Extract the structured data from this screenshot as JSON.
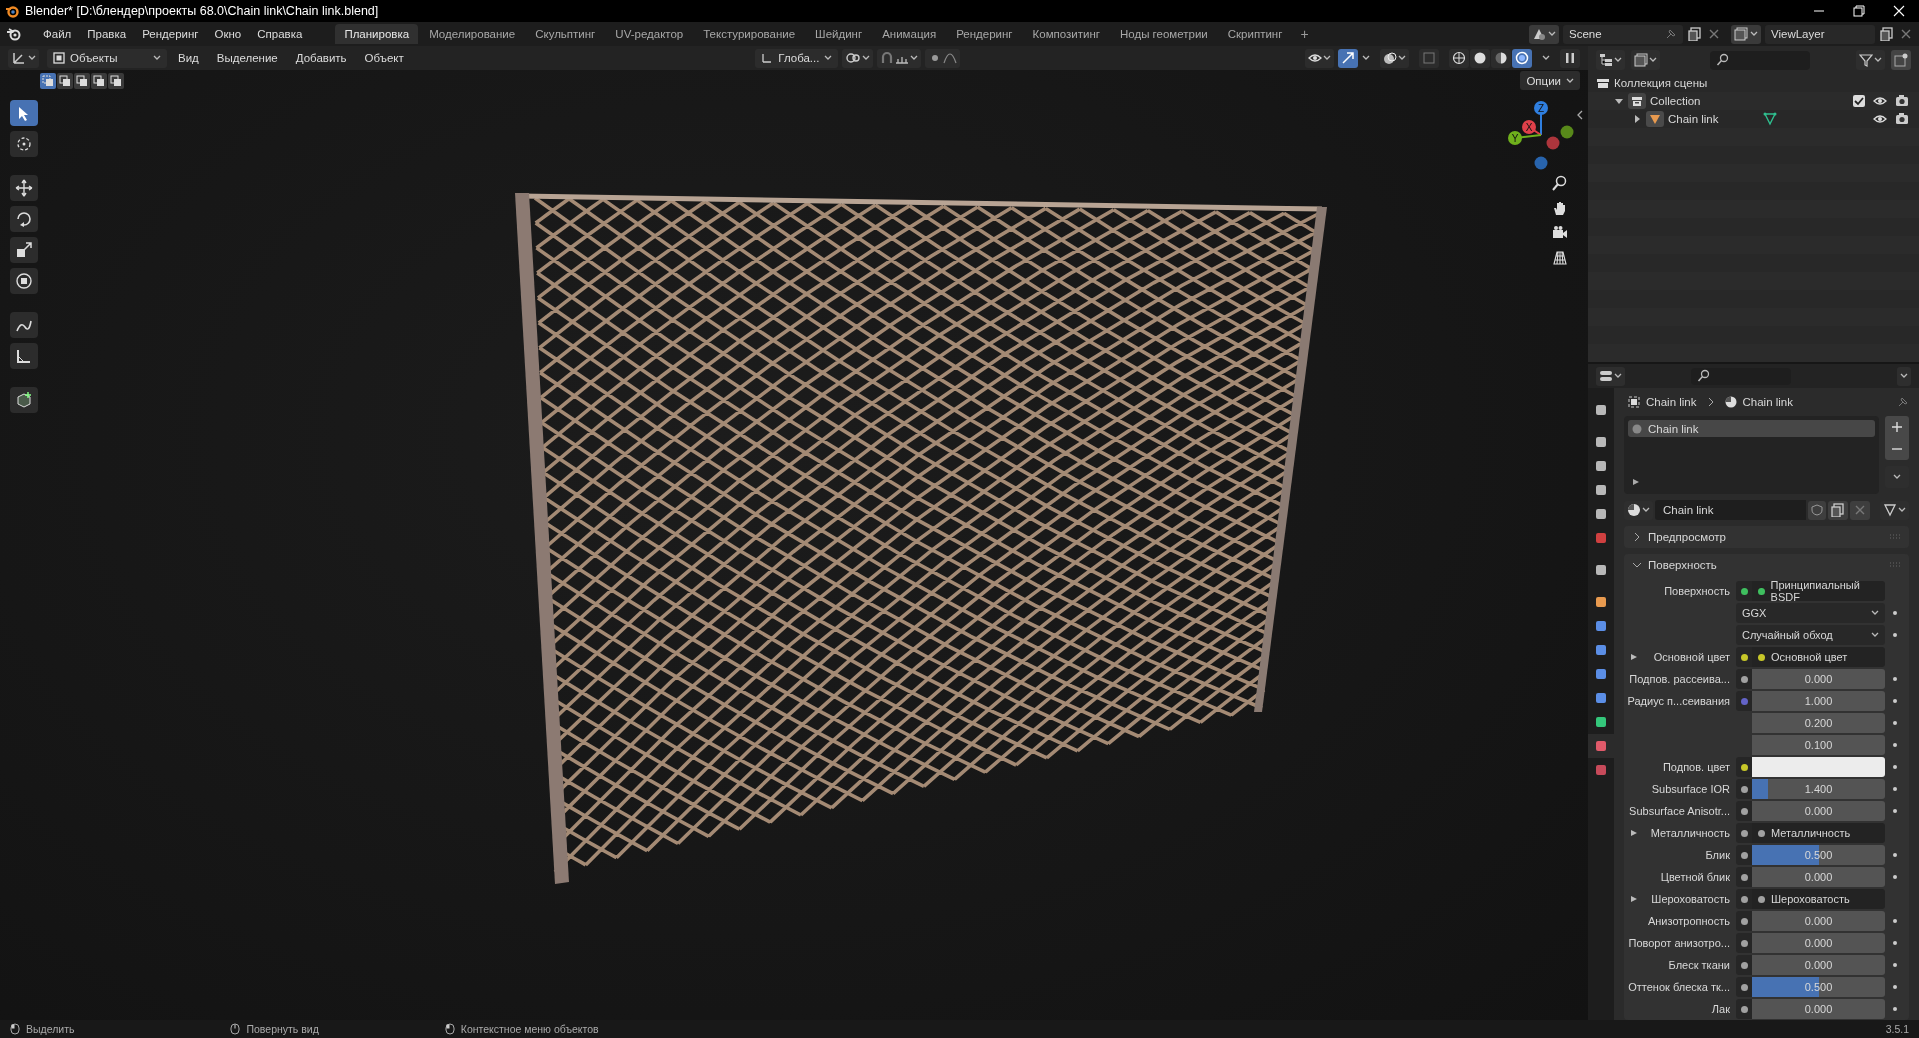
{
  "window": {
    "title": "Blender* [D:\\блендер\\проекты 68.0\\Chain link\\Chain link.blend]"
  },
  "menu": [
    "Файл",
    "Правка",
    "Рендеринг",
    "Окно",
    "Справка"
  ],
  "workspaces": [
    {
      "label": "Планировка",
      "selected": true
    },
    {
      "label": "Моделирование",
      "selected": false
    },
    {
      "label": "Скульптинг",
      "selected": false
    },
    {
      "label": "UV-редактор",
      "selected": false
    },
    {
      "label": "Текстурирование",
      "selected": false
    },
    {
      "label": "Шейдинг",
      "selected": false
    },
    {
      "label": "Анимация",
      "selected": false
    },
    {
      "label": "Рендеринг",
      "selected": false
    },
    {
      "label": "Композитинг",
      "selected": false
    },
    {
      "label": "Ноды геометрии",
      "selected": false
    },
    {
      "label": "Скриптинг",
      "selected": false
    }
  ],
  "add_workspace": "+",
  "scene": {
    "name": "Scene"
  },
  "view_layer": {
    "name": "ViewLayer"
  },
  "viewport": {
    "mode": "Объекты",
    "menus": [
      "Вид",
      "Выделение",
      "Добавить",
      "Объект"
    ],
    "orientation": "Глоба...",
    "options": "Опции",
    "select_modes": [
      {
        "selected": true
      },
      {
        "selected": false
      },
      {
        "selected": false
      },
      {
        "selected": false
      },
      {
        "selected": false
      }
    ],
    "tools": [
      {
        "selected": true
      },
      {
        "selected": false
      },
      {
        "selected": false
      },
      {
        "selected": false
      },
      {
        "selected": false
      },
      {
        "selected": false
      },
      {
        "selected": false
      },
      {
        "selected": false
      },
      {
        "selected": false
      }
    ],
    "proportional": {
      "on": false
    },
    "gizmo_toggle": {
      "on": true
    },
    "overlay": {
      "on": false
    },
    "xray": {
      "on": false
    },
    "shading_modes": [
      {
        "selected": false
      },
      {
        "selected": false
      },
      {
        "selected": false
      },
      {
        "selected": true
      }
    ],
    "gizmo": [
      {
        "label": "Z",
        "color": "#2f7fe0"
      },
      {
        "label": "X",
        "color": "#e0404a"
      },
      {
        "label": "Y",
        "color": "#6fb01c"
      }
    ]
  },
  "outliner": {
    "tree": [
      {
        "kind": "scene_collection",
        "name": "Коллекция сцены",
        "children": [
          {
            "kind": "collection",
            "name": "Collection",
            "expanded": true,
            "checked": true,
            "children": [
              {
                "kind": "object",
                "name": "Chain link",
                "expanded": false
              }
            ]
          }
        ]
      }
    ]
  },
  "properties": {
    "tabs": [
      {
        "color": "#b8b8b8",
        "selected": false
      },
      {
        "color": "#b8b8b8",
        "selected": false
      },
      {
        "color": "#b8b8b8",
        "selected": false
      },
      {
        "color": "#b8b8b8",
        "selected": false
      },
      {
        "color": "#b8b8b8",
        "selected": false
      },
      {
        "color": "#d04040",
        "selected": false
      },
      {
        "color": "#b8b8b8",
        "selected": false
      },
      {
        "color": "#e89a4f",
        "selected": false
      },
      {
        "color": "#5b8ee6",
        "selected": false
      },
      {
        "color": "#5b8ee6",
        "selected": false
      },
      {
        "color": "#5b8ee6",
        "selected": false
      },
      {
        "color": "#5b8ee6",
        "selected": false
      },
      {
        "color": "#34c77b",
        "selected": false
      },
      {
        "color": "#e05a6a",
        "selected": true
      },
      {
        "color": "#c74a5a",
        "selected": false
      }
    ],
    "breadcrumb": [
      "Chain link",
      "Chain link"
    ],
    "material_slots": [
      {
        "name": "Chain link",
        "selected": true
      }
    ],
    "material": "Chain link",
    "panels": [
      {
        "title": "Предпросмотр",
        "expanded": false
      },
      {
        "title": "Поверхность",
        "expanded": true,
        "rows": [
          {
            "kind": "link",
            "label": "Поверхность",
            "color": "#3fbf5f",
            "value": "Принципиальный BSDF"
          },
          {
            "kind": "select",
            "value": "GGX"
          },
          {
            "kind": "select",
            "value": "Случайный обход"
          },
          {
            "kind": "link",
            "label": "Основной цвет",
            "color": "#c7c729",
            "value": "Основной цвет",
            "expanded": false
          },
          {
            "kind": "slider",
            "label": "Подпов. рассеива...",
            "color": "#a1a1a1",
            "value": "0.000",
            "level": 0
          },
          {
            "kind": "vector",
            "label": "Радиус п...сеивания",
            "color": "#6363c7",
            "values": [
              "1.000",
              "0.200",
              "0.100"
            ]
          },
          {
            "kind": "color",
            "label": "Подпов. цвет",
            "color": "#c7c729"
          },
          {
            "kind": "slider",
            "label": "Subsurface IOR",
            "color": "#a1a1a1",
            "value": "1.400",
            "level": 0.12
          },
          {
            "kind": "slider",
            "label": "Subsurface Anisotr...",
            "color": "#a1a1a1",
            "value": "0.000",
            "level": 0
          },
          {
            "kind": "link",
            "label": "Металличность",
            "color": "#a1a1a1",
            "value": "Металличность",
            "expanded": false
          },
          {
            "kind": "slider",
            "label": "Блик",
            "color": "#a1a1a1",
            "value": "0.500",
            "level": 0.5
          },
          {
            "kind": "slider",
            "label": "Цветной блик",
            "color": "#a1a1a1",
            "value": "0.000",
            "level": 0
          },
          {
            "kind": "link",
            "label": "Шероховатость",
            "color": "#a1a1a1",
            "value": "Шероховатость",
            "expanded": false
          },
          {
            "kind": "slider",
            "label": "Анизотропность",
            "color": "#a1a1a1",
            "value": "0.000",
            "level": 0
          },
          {
            "kind": "slider",
            "label": "Поворот анизотро...",
            "color": "#a1a1a1",
            "value": "0.000",
            "level": 0
          },
          {
            "kind": "slider",
            "label": "Блеск ткани",
            "color": "#a1a1a1",
            "value": "0.000",
            "level": 0
          },
          {
            "kind": "slider",
            "label": "Оттенок блеска тк...",
            "color": "#a1a1a1",
            "value": "0.500",
            "level": 0.5
          },
          {
            "kind": "slider",
            "label": "Лак",
            "color": "#a1a1a1",
            "value": "0.000",
            "level": 0
          }
        ]
      }
    ]
  },
  "status_bar": {
    "hints": [
      "Выделить",
      "Повернуть вид",
      "Контекстное меню объектов"
    ],
    "version": "3.5.1"
  }
}
